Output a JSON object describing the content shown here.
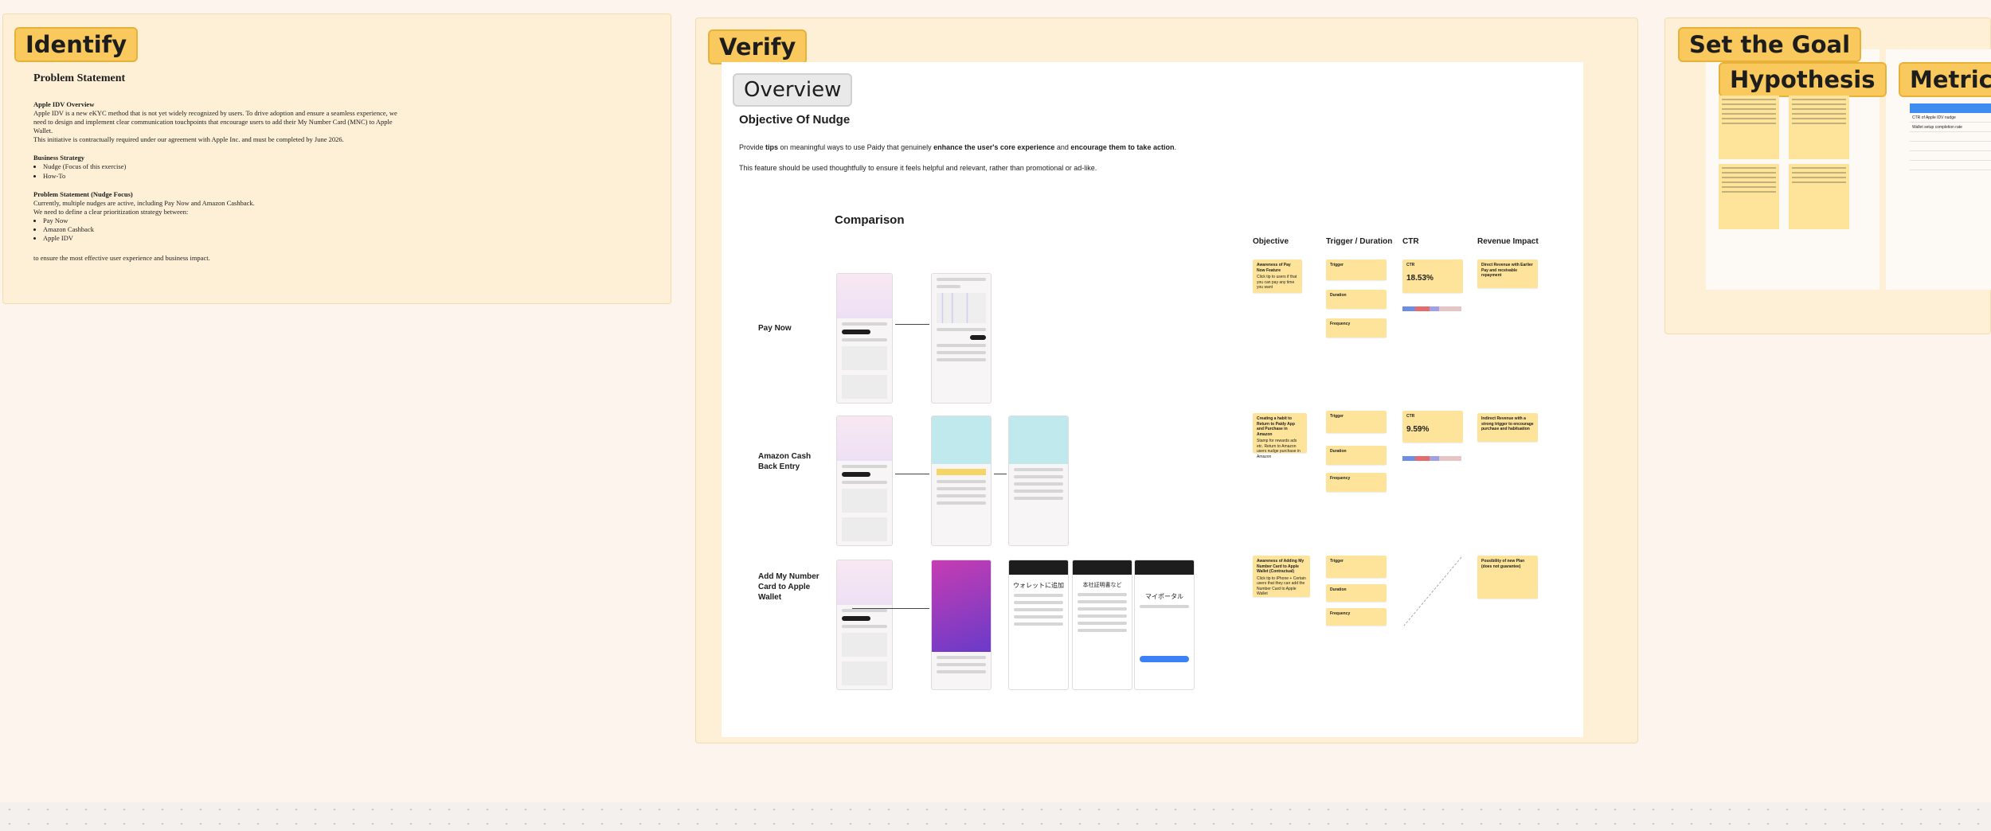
{
  "sections": {
    "identify": "Identify",
    "verify": "Verify",
    "set_goal": "Set the Goal",
    "hypothesis": "Hypothesis",
    "metrics": "Metrics"
  },
  "identify": {
    "heading": "Problem Statement",
    "apple_title": "Apple IDV Overview",
    "apple_text": "Apple IDV is a new eKYC method that is not yet widely recognized by users. To drive adoption and ensure a seamless experience, we need to design and implement clear communication touchpoints that encourage users to add their My Number Card (MNC) to Apple Wallet.",
    "apple_text2": "This initiative is contractually required under our agreement with Apple Inc. and must be completed by June 2026.",
    "strategy_title": "Business Strategy",
    "strategy_items": [
      "Nudge (Focus of this exercise)",
      "How-To"
    ],
    "ps_title": "Problem Statement (Nudge Focus)",
    "ps_text1": "Currently, multiple nudges are active, including Pay Now and Amazon Cashback.",
    "ps_text2": "We need to define a clear prioritization strategy between:",
    "ps_items": [
      "Pay Now",
      "Amazon Cashback",
      "Apple IDV"
    ],
    "ps_footer": "to ensure the most effective user experience and business impact."
  },
  "verify": {
    "overview": "Overview",
    "objective_title": "Objective Of Nudge",
    "objective_desc_1": "Provide ",
    "objective_desc_tips": "tips",
    "objective_desc_2": " on meaningful ways to use Paidy that genuinely ",
    "objective_desc_b1": "enhance the user's core experience",
    "objective_desc_3": " and ",
    "objective_desc_b2": "encourage them to take action",
    "objective_desc_4": ".",
    "objective_desc2": "This feature should be used thoughtfully to ensure it feels helpful and relevant, rather than promotional or ad-like.",
    "comparison": "Comparison",
    "columns": [
      "Objective",
      "Trigger / Duration",
      "CTR",
      "Revenue Impact"
    ],
    "rows": [
      {
        "label": "Pay Now",
        "objective": "Awareness of Pay Now Feature",
        "objective_note": "Click tip to users if that you can pay any time you want",
        "ctr": "18.53%",
        "revenue": "Direct Revenue with Earlier Pay and receivable repayment"
      },
      {
        "label": "Amazon Cash Back Entry",
        "objective": "Creating a habit to Return to Paidy App and Purchase in Amazon",
        "objective_note": "Stamp for rewards ads etc. Return to Amazon users nudge purchase in Amazon",
        "ctr": "9.59%",
        "revenue": "Indirect Revenue with a strong trigger to encourage purchase and habituation"
      },
      {
        "label": "Add My Number Card to Apple Wallet",
        "objective": "Awareness of Adding My Number Card to Apple Wallet (Contractual)",
        "objective_note": "Click tip to iPhone + Certain users that they can add the Number Card to Apple Wallet",
        "ctr": "",
        "revenue": "Possibility of new Plan (does not guarantee)"
      }
    ],
    "trigger_labels": [
      "Trigger",
      "Duration",
      "Frequency"
    ],
    "ctr_label": "CTR",
    "jp_screens": [
      "ウォレットに追加",
      "本社証明書など",
      "マイポータル"
    ]
  },
  "goal": {
    "metrics_rows": [
      "CTR of Apple IDV nudge",
      "Wallet setup completion rate"
    ]
  }
}
